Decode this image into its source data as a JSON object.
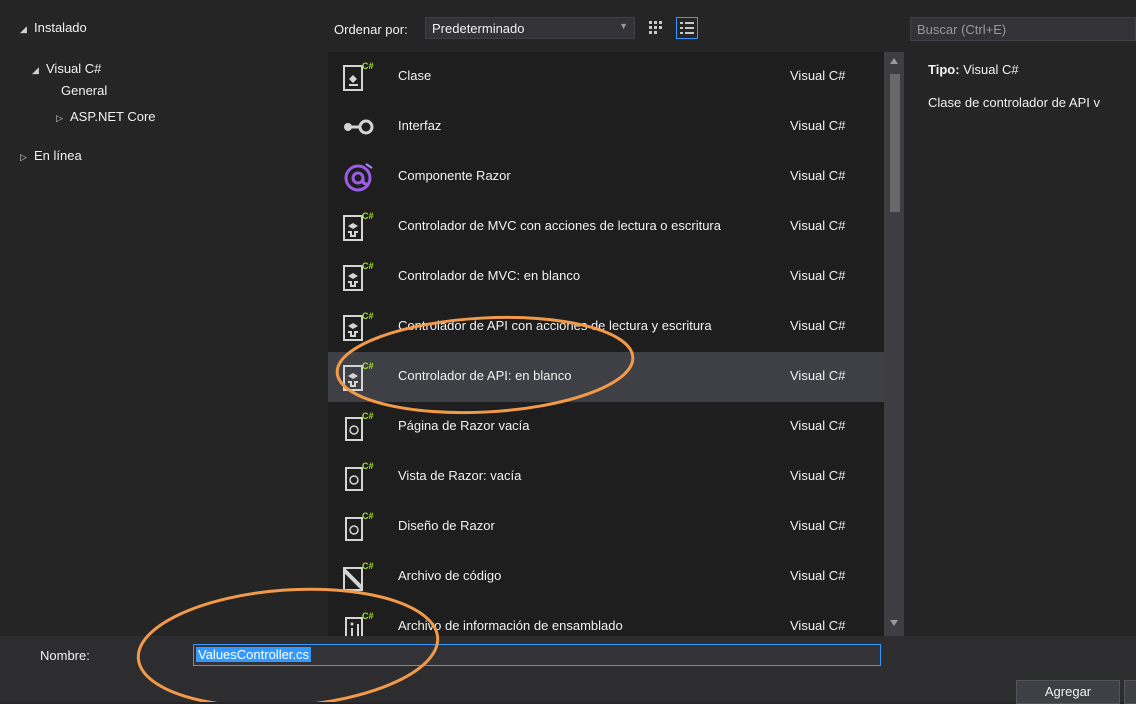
{
  "tree": {
    "installed": "Instalado",
    "visual_csharp": "Visual C#",
    "general": "General",
    "aspnet_core": "ASP.NET Core",
    "online": "En línea"
  },
  "sort": {
    "label": "Ordenar por:",
    "value": "Predeterminado"
  },
  "search": {
    "placeholder": "Buscar (Ctrl+E)"
  },
  "templates": [
    {
      "name": "Clase",
      "lang": "Visual C#",
      "icon": "class-icon"
    },
    {
      "name": "Interfaz",
      "lang": "Visual C#",
      "icon": "interface-icon"
    },
    {
      "name": "Componente Razor",
      "lang": "Visual C#",
      "icon": "razor-component-icon"
    },
    {
      "name": "Controlador de MVC con acciones de lectura o escritura",
      "lang": "Visual C#",
      "icon": "controller-icon"
    },
    {
      "name": "Controlador de MVC: en blanco",
      "lang": "Visual C#",
      "icon": "controller-icon"
    },
    {
      "name": "Controlador de API con acciones de lectura y escritura",
      "lang": "Visual C#",
      "icon": "controller-icon"
    },
    {
      "name": "Controlador de API: en blanco",
      "lang": "Visual C#",
      "icon": "controller-icon"
    },
    {
      "name": "Página de Razor vacía",
      "lang": "Visual C#",
      "icon": "razor-page-icon"
    },
    {
      "name": "Vista de Razor: vacía",
      "lang": "Visual C#",
      "icon": "razor-page-icon"
    },
    {
      "name": "Diseño de Razor",
      "lang": "Visual C#",
      "icon": "razor-page-icon"
    },
    {
      "name": "Archivo de código",
      "lang": "Visual C#",
      "icon": "code-file-icon"
    },
    {
      "name": "Archivo de información de ensamblado",
      "lang": "Visual C#",
      "icon": "assembly-info-icon"
    }
  ],
  "info": {
    "type_label": "Tipo:",
    "type_value": "Visual C#",
    "description": "Clase de controlador de API v"
  },
  "name_field": {
    "label": "Nombre:",
    "value": "ValuesController.cs"
  },
  "buttons": {
    "add": "Agregar"
  },
  "colors": {
    "accent": "#3399ff",
    "annotation": "#f29a4a",
    "csharp_badge": "#a6e22e",
    "razor_purple": "#9b5de5"
  }
}
